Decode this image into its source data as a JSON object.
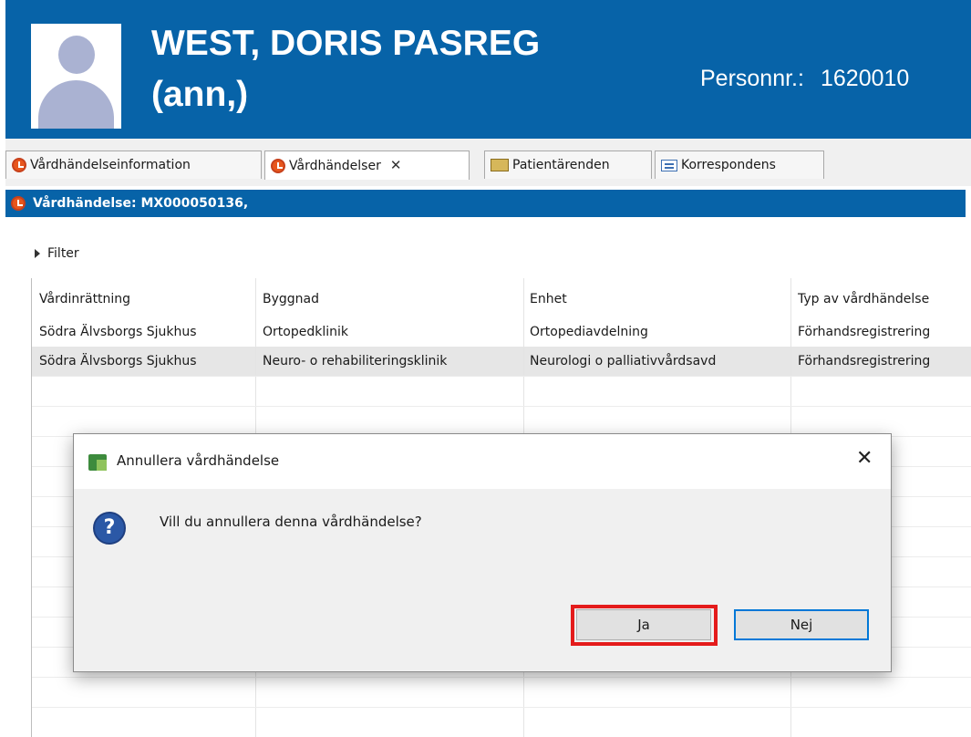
{
  "header": {
    "patient_name_line1": "WEST, DORIS PASREG",
    "patient_name_line2": "(ann,)",
    "personnr_label": "Personnr.:",
    "personnr_value": "1620010"
  },
  "tabs": [
    {
      "label": "Vårdhändelseinformation",
      "icon": "clock-icon"
    },
    {
      "label": "Vårdhändelser",
      "icon": "clock-icon",
      "active": true
    },
    {
      "label": "Patientärenden",
      "icon": "book-icon"
    },
    {
      "label": "Korrespondens",
      "icon": "mail-icon"
    }
  ],
  "panel_title": "Vårdhändelse: MX000050136,",
  "filter_label": "Filter",
  "table": {
    "columns": [
      "Vårdinrättning",
      "Byggnad",
      "Enhet",
      "Typ av vårdhändelse"
    ],
    "rows": [
      [
        "Södra Älvsborgs Sjukhus",
        "Ortopedklinik",
        "Ortopediavdelning",
        "Förhandsregistrering"
      ],
      [
        "Södra Älvsborgs Sjukhus",
        "Neuro- o rehabiliteringsklinik",
        "Neurologi o palliativvårdsavd",
        "Förhandsregistrering"
      ]
    ]
  },
  "dialog": {
    "title": "Annullera vårdhändelse",
    "message": "Vill du annullera denna vårdhändelse?",
    "yes_label": "Ja",
    "no_label": "Nej",
    "close_glyph": "✕",
    "question_glyph": "?"
  },
  "colors": {
    "header_bg": "#0763a8",
    "highlight": "#e41b1b"
  }
}
